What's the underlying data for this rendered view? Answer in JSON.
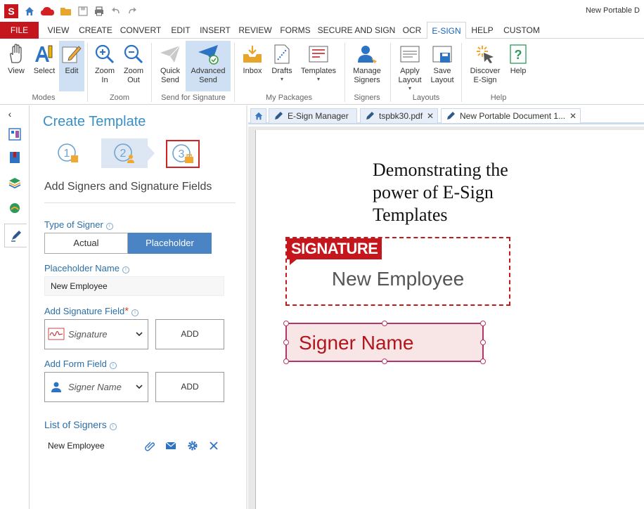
{
  "window": {
    "title": "New Portable D",
    "app_badge": "S"
  },
  "menu": {
    "tabs": [
      "FILE",
      "VIEW",
      "CREATE",
      "CONVERT",
      "EDIT",
      "INSERT",
      "REVIEW",
      "FORMS",
      "SECURE AND SIGN",
      "OCR",
      "E-SIGN",
      "HELP",
      "CUSTOM"
    ],
    "active": "E-SIGN"
  },
  "ribbon": {
    "buttons": {
      "view": "View",
      "select": "Select",
      "edit": "Edit",
      "zoom_in": "Zoom\nIn",
      "zoom_out": "Zoom\nOut",
      "quick_send": "Quick\nSend",
      "advanced_send": "Advanced\nSend",
      "inbox": "Inbox",
      "drafts": "Drafts",
      "templates": "Templates",
      "manage_signers": "Manage\nSigners",
      "apply_layout": "Apply\nLayout",
      "save_layout": "Save\nLayout",
      "discover": "Discover\nE-Sign",
      "help": "Help"
    },
    "groups": {
      "modes": "Modes",
      "zoom": "Zoom",
      "send": "Send for Signature",
      "packages": "My Packages",
      "signers": "Signers",
      "layouts": "Layouts",
      "help": "Help"
    }
  },
  "panel": {
    "title": "Create Template",
    "subtitle": "Add Signers and Signature Fields",
    "steps": [
      "1",
      "2",
      "3"
    ],
    "type_of_signer_label": "Type of Signer",
    "signer_types": [
      "Actual",
      "Placeholder"
    ],
    "selected_signer_type": "Placeholder",
    "placeholder_name_label": "Placeholder Name",
    "placeholder_name_value": "New Employee",
    "add_signature_field_label": "Add Signature Field",
    "required_mark": "*",
    "signature_field_value": "Signature",
    "add_button": "ADD",
    "add_form_field_label": "Add Form Field",
    "form_field_value": "Signer Name",
    "list_of_signers_label": "List of Signers",
    "signers": [
      "New Employee"
    ]
  },
  "doc_tabs": [
    "E-Sign Manager",
    "tspbk30.pdf",
    "New Portable Document 1..."
  ],
  "document": {
    "heading": "Demonstrating the power of E-Sign Templates",
    "signature_tag": "SIGNATURE",
    "signature_signer": "New Employee",
    "form_field_text": "Signer Name"
  },
  "colors": {
    "accent": "#c4161c",
    "brand_blue": "#3a8fc7",
    "selected_bg": "#cfe0f5",
    "placeholder_btn": "#4a84c4"
  }
}
